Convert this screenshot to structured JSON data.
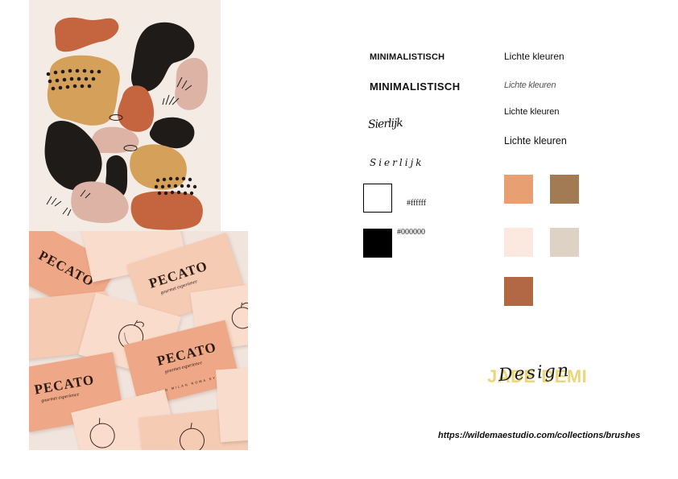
{
  "typography": {
    "headline_a": "MINIMALISTISCH",
    "headline_b": "MINIMALISTISCH",
    "script_a": "Sierlijk",
    "script_b": "Sierlijk",
    "light_a": "Lichte kleuren",
    "light_b": "Lichte kleuren",
    "light_c": "Lichte kleuren",
    "light_d": "Lichte kleuren"
  },
  "basics": {
    "white_hex": "#ffffff",
    "black_hex": "#000000"
  },
  "palette": [
    "#e8a072",
    "#a27a53",
    "#fbe9df",
    "#ddd2c3",
    "#b26845"
  ],
  "art_colors": {
    "background": "#f4ebe5",
    "rust": "#c4653f",
    "ochre": "#d4a05a",
    "charcoal": "#1e1b19",
    "blush": "#dcb3a4"
  },
  "cards": {
    "brand": "PECATO",
    "tagline": "gourmet experience",
    "footer": "MADRID  MILÁN  ROMA  SYDNEY",
    "colors": [
      "#efa887",
      "#f5cbb4",
      "#f9dccb"
    ]
  },
  "logo": {
    "main": "JADE DEMI",
    "script": "Design",
    "color": "#ecd67a"
  },
  "url": "https://wildemaestudio.com/collections/brushes"
}
